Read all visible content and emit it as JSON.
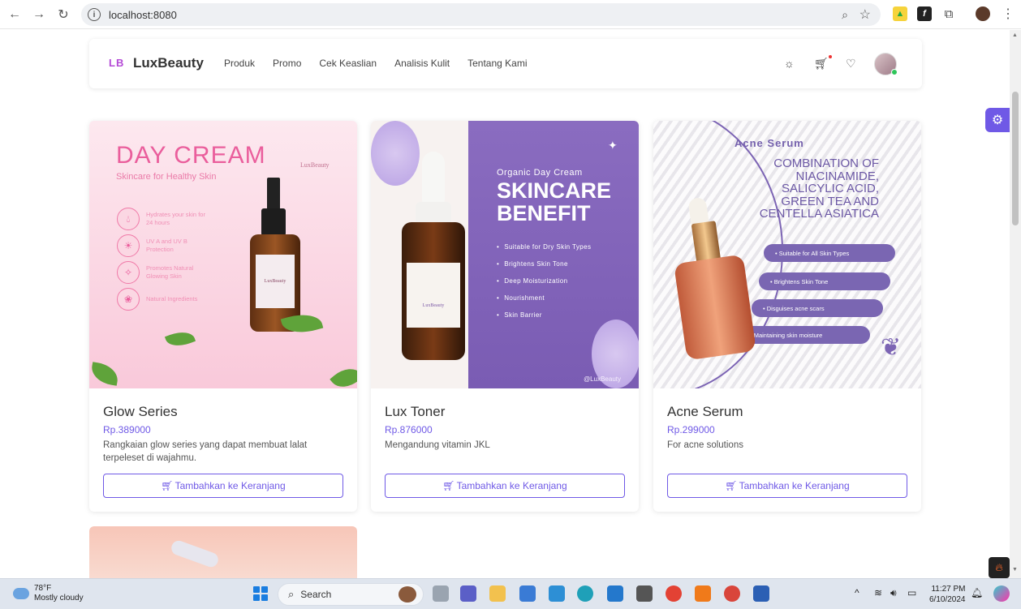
{
  "browser": {
    "url": "localhost:8080",
    "back_icon": "arrow-left-icon",
    "forward_icon": "arrow-right-icon",
    "reload_icon": "reload-icon"
  },
  "site": {
    "logo_mark": "LB",
    "logo_text": "LuxBeauty",
    "nav": [
      "Produk",
      "Promo",
      "Cek Keaslian",
      "Analisis Kulit",
      "Tentang Kami"
    ]
  },
  "products": [
    {
      "name": "Glow Series",
      "price": "Rp.389000",
      "description": "Rangkaian glow series yang dapat membuat lalat terpeleset di wajahmu.",
      "cta": "Tambahkan ke Keranjang",
      "poster": {
        "title": "DAY CREAM",
        "subtitle": "Skincare for Healthy Skin",
        "brand": "LuxBeauty",
        "features": [
          "Hydrates your skin for 24 hours",
          "UV A and UV B Protection",
          "Promotes Natural Glowing Skin",
          "Natural Ingredients"
        ],
        "bottle_label": "LuxBeauty"
      }
    },
    {
      "name": "Lux Toner",
      "price": "Rp.876000",
      "description": "Mengandung vitamin JKL",
      "cta": "Tambahkan ke Keranjang",
      "poster": {
        "kicker": "Organic Day Cream",
        "headline_1": "SKINCARE",
        "headline_2": "BENEFIT",
        "benefits": [
          "Suitable for Dry Skin Types",
          "Brightens Skin Tone",
          "Deep Moisturization",
          "Nourishment",
          "Skin Barrier"
        ],
        "handle": "@LuxBeauty",
        "bottle_label": "LuxBeauty"
      }
    },
    {
      "name": "Acne Serum",
      "price": "Rp.299000",
      "description": "For acne solutions",
      "cta": "Tambahkan ke Keranjang",
      "poster": {
        "title": "Acne Serum",
        "combo": "COMBINATION OF NIACINAMIDE, SALICYLIC ACID, GREEN TEA AND CENTELLA ASIATICA",
        "pills": [
          "• Suitable for All Skin Types",
          "• Brightens Skin Tone",
          "• Disguises acne scars",
          "• Maintaining skin moisture"
        ]
      }
    }
  ],
  "taskbar": {
    "temperature": "78°F",
    "weather": "Mostly cloudy",
    "search_label": "Search",
    "time": "11:27 PM",
    "date": "6/10/2024"
  },
  "colors": {
    "accent": "#6f59e6",
    "logo_accent": "#b44ad6"
  }
}
